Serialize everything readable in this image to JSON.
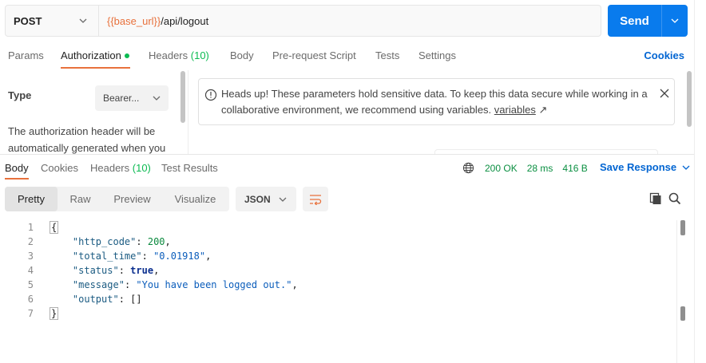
{
  "request": {
    "method": "POST",
    "url_variable": "{{base_url}}",
    "url_path": "/api/logout",
    "send_label": "Send"
  },
  "request_tabs": {
    "params": "Params",
    "authorization": "Authorization",
    "headers": "Headers",
    "headers_count": "(10)",
    "body": "Body",
    "pre_request": "Pre-request Script",
    "tests": "Tests",
    "settings": "Settings",
    "cookies": "Cookies"
  },
  "auth": {
    "type_label": "Type",
    "type_value": "Bearer...",
    "description": "The authorization header will be automatically generated when you",
    "alert_text": "Heads up! These parameters hold sensitive data. To keep this data secure while working in a collaborative environment, we recommend using variables.",
    "alert_link": "variables",
    "alert_link_arrow": "↗"
  },
  "response_tabs": {
    "body": "Body",
    "cookies": "Cookies",
    "headers": "Headers",
    "headers_count": "(10)",
    "test_results": "Test Results"
  },
  "response_status": {
    "status": "200 OK",
    "time": "28 ms",
    "size": "416 B",
    "save_label": "Save Response"
  },
  "format_bar": {
    "pretty": "Pretty",
    "raw": "Raw",
    "preview": "Preview",
    "visualize": "Visualize",
    "format": "JSON"
  },
  "code": {
    "line_numbers": [
      "1",
      "2",
      "3",
      "4",
      "5",
      "6",
      "7"
    ],
    "open_brace": "{",
    "close_brace": "}",
    "entries": [
      {
        "key": "\"http_code\"",
        "value": "200",
        "type": "num",
        "comma": ","
      },
      {
        "key": "\"total_time\"",
        "value": "\"0.01918\"",
        "type": "str",
        "comma": ","
      },
      {
        "key": "\"status\"",
        "value": "true",
        "type": "bool",
        "comma": ","
      },
      {
        "key": "\"message\"",
        "value": "\"You have been logged out.\"",
        "type": "str",
        "comma": ","
      },
      {
        "key": "\"output\"",
        "value": "[]",
        "type": "plain",
        "comma": ""
      }
    ]
  },
  "colors": {
    "accent_orange": "#e8713c",
    "primary_blue": "#097bed",
    "success_green": "#0cbb52"
  }
}
